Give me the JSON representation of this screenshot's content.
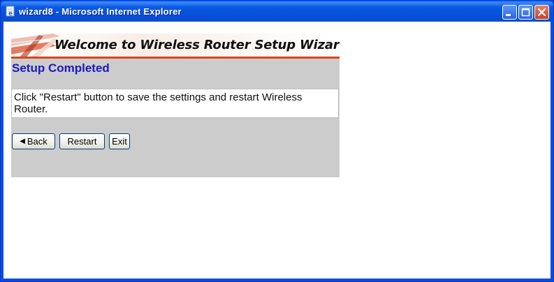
{
  "window": {
    "title": "wizard8 - Microsoft Internet Explorer"
  },
  "banner": {
    "title": "Welcome to Wireless Router Setup Wizard"
  },
  "page": {
    "heading": "Setup Completed",
    "message": "Click \"Restart\" button to save the settings and restart Wireless Router."
  },
  "buttons": {
    "back": "Back",
    "restart": "Restart",
    "exit": "Exit"
  },
  "colors": {
    "titlebar": "#0a58e2",
    "panel": "#cccccc",
    "heading": "#1a1abf",
    "banner_accent": "#d8461e"
  }
}
